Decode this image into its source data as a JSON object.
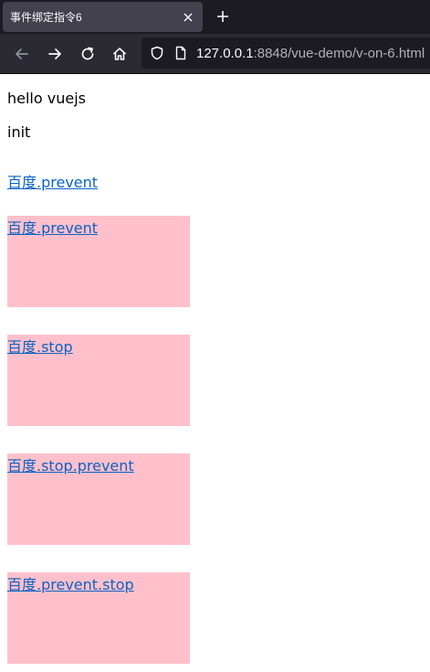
{
  "browser": {
    "tab": {
      "title": "事件绑定指令6",
      "close_icon": "close-icon"
    },
    "new_tab_icon": "plus-icon",
    "nav": {
      "back_icon": "arrow-left-icon",
      "forward_icon": "arrow-right-icon",
      "reload_icon": "reload-icon",
      "home_icon": "home-icon"
    },
    "url": {
      "security_icon": "shield-icon",
      "page_icon": "page-icon",
      "host": "127.0.0.1",
      "path": ":8848/vue-demo/v-on-6.html"
    }
  },
  "page": {
    "message": "hello vuejs",
    "status": "init",
    "link_plain": "百度.prevent",
    "boxes": [
      {
        "link": "百度.prevent"
      },
      {
        "link": "百度.stop"
      },
      {
        "link": "百度.stop.prevent"
      },
      {
        "link": "百度.prevent.stop"
      }
    ],
    "colors": {
      "box_background": "#ffc0cb",
      "link": "#0b62c4"
    }
  }
}
